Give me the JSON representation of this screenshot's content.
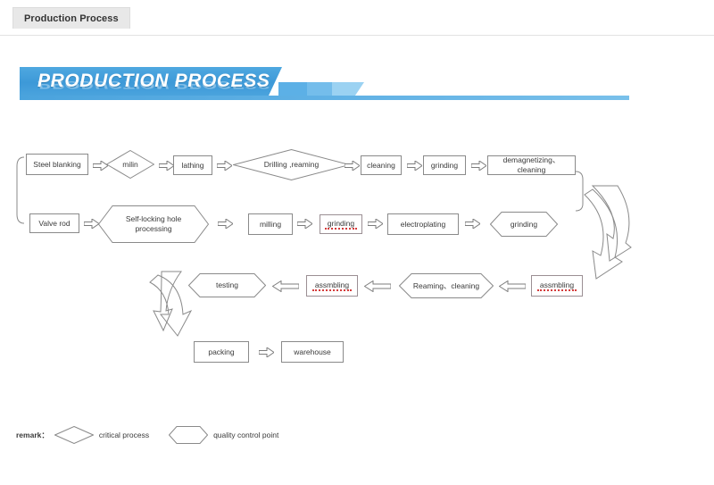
{
  "tab": {
    "label": "Production Process"
  },
  "banner": {
    "title": "PRODUCTION PROCESS",
    "accent_color": "#3d99d8",
    "light_color": "#9bd2f2"
  },
  "flow": {
    "row1": [
      {
        "id": "steel-blanking",
        "label": "Steel blanking",
        "shape": "rect"
      },
      {
        "id": "milin",
        "label": "milin",
        "shape": "diamond"
      },
      {
        "id": "lathing",
        "label": "lathing",
        "shape": "rect"
      },
      {
        "id": "drilling-reaming",
        "label": "Drilling ,reaming",
        "shape": "diamond"
      },
      {
        "id": "cleaning",
        "label": "cleaning",
        "shape": "rect"
      },
      {
        "id": "grinding-1",
        "label": "grinding",
        "shape": "rect"
      },
      {
        "id": "demagnetizing-cleaning",
        "label": "demagnetizing、cleaning",
        "shape": "rect"
      }
    ],
    "row2": [
      {
        "id": "valve-rod",
        "label": "Valve rod",
        "shape": "rect"
      },
      {
        "id": "self-locking-hole-processing",
        "label": "Self-locking  hole\nprocessing",
        "shape": "hex"
      },
      {
        "id": "milling",
        "label": "milling",
        "shape": "rect"
      },
      {
        "id": "grinding-2",
        "label": "grinding",
        "shape": "rect",
        "spellcheck_error": true
      },
      {
        "id": "electroplating",
        "label": "electroplating",
        "shape": "rect"
      },
      {
        "id": "grinding-3",
        "label": "grinding",
        "shape": "hex"
      }
    ],
    "row3": [
      {
        "id": "testing",
        "label": "testing",
        "shape": "hex"
      },
      {
        "id": "assmbling-1",
        "label": "assmbling",
        "shape": "rect",
        "spellcheck_error": true
      },
      {
        "id": "reaming-cleaning",
        "label": "Reaming、cleaning",
        "shape": "hex"
      },
      {
        "id": "assmbling-2",
        "label": "assmbling",
        "shape": "rect",
        "spellcheck_error": true
      }
    ],
    "row4": [
      {
        "id": "packing",
        "label": "packing",
        "shape": "rect"
      },
      {
        "id": "warehouse",
        "label": "warehouse",
        "shape": "rect"
      }
    ]
  },
  "legend": {
    "remark_label": "remark：",
    "items": [
      {
        "shape": "diamond",
        "label": "critical process"
      },
      {
        "shape": "hex",
        "label": "quality control point"
      }
    ]
  }
}
